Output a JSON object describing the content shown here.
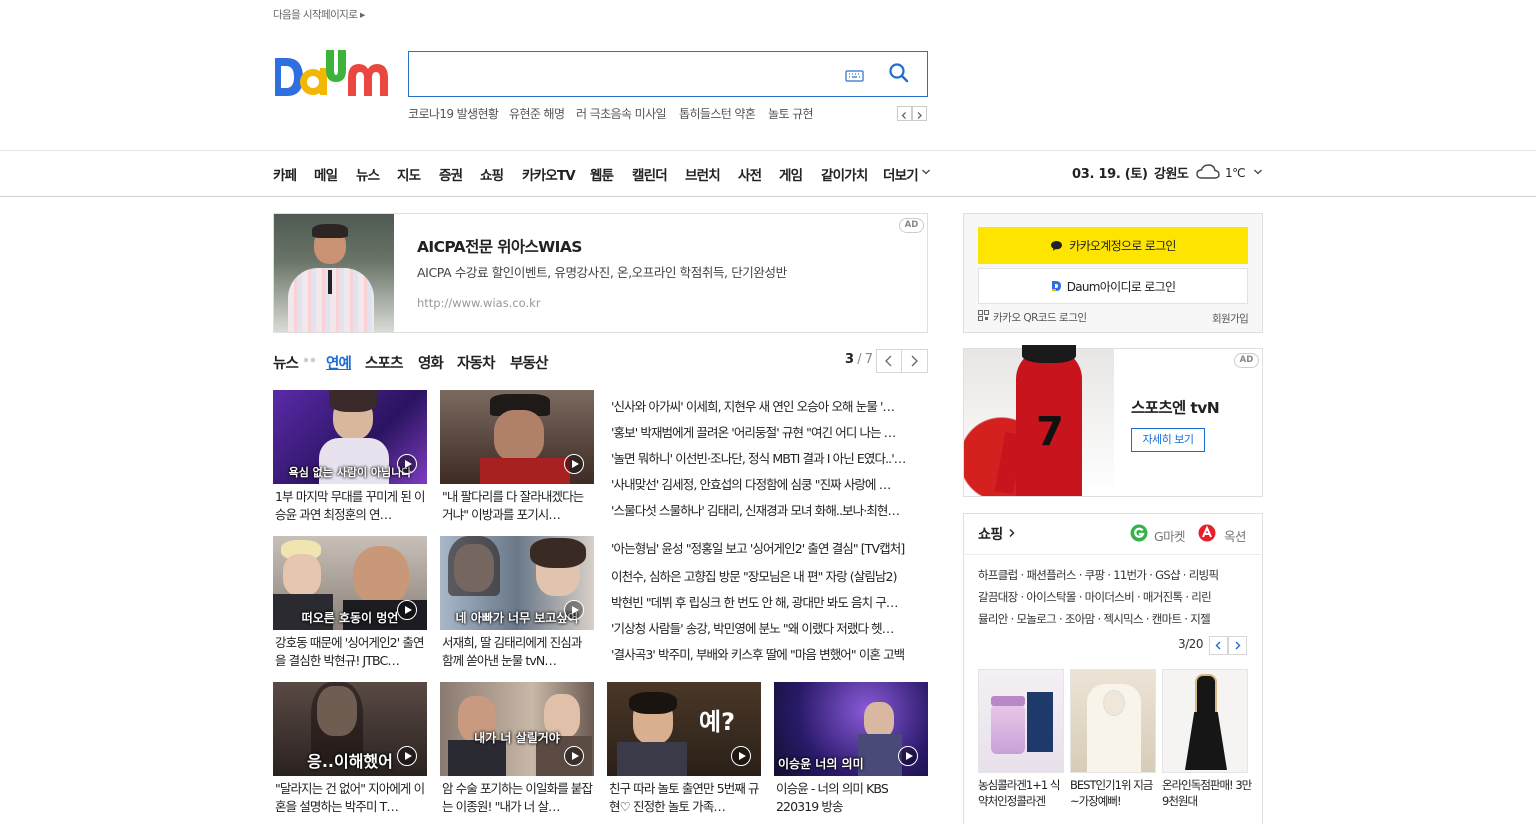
{
  "top": {
    "start_link": "다음을 시작페이지로"
  },
  "search": {
    "placeholder": ""
  },
  "trending": [
    "코로나19 발생현황",
    "유현준 해명",
    "러 극초음속 미사일",
    "톱히들스턴 약혼",
    "놀토 규현"
  ],
  "gnb": [
    "카페",
    "메일",
    "뉴스",
    "지도",
    "증권",
    "쇼핑",
    "카카오TV",
    "웹툰",
    "캘린더",
    "브런치",
    "사전",
    "게임",
    "같이가치",
    "더보기"
  ],
  "weather": {
    "date": "03. 19. (토)",
    "region": "강원도",
    "temp": "1℃"
  },
  "ad": {
    "badge": "AD",
    "title": "AICPA전문 위아스WIAS",
    "desc": "AICPA 수강료 할인이벤트, 유명강사진, 온,오프라인 학점취득, 단기완성반",
    "url": "http://www.wias.co.kr"
  },
  "news_tabs": {
    "items": [
      "뉴스",
      "연예",
      "스포츠",
      "영화",
      "자동차",
      "부동산"
    ],
    "page_current": "3",
    "page_total": "/ 7"
  },
  "cards_left": [
    {
      "title": "1부 마지막 무대를 꾸미게 된 이승윤 과연 최정훈의 연…",
      "caption": "욕심 없는 사람이 아님니다"
    },
    {
      "title": "\"내 팔다리를 다 잘라내겠다는 거냐\" 이방과를 포기시…",
      "caption": ""
    },
    {
      "title": "강호동 때문에 '싱어게인2' 출연을 결심한 박현규! JTBC…",
      "caption": "떠오른 호동이 멍언"
    },
    {
      "title": "서재희, 딸 김태리에게 진심과 함께 쏟아낸 눈물 tvN…",
      "caption": "네 아빠가 너무 보고싶어"
    }
  ],
  "headlines": [
    "'신사와 아가씨' 이세희, 지현우 새 연인 오승아 오해 눈물 '…",
    "'홍보' 박재범에게 끌려온 '어리둥절' 규현 \"여긴 어디 나는 …",
    "'놀면 뭐하니' 이선빈·조나단, 정식 MBTI 결과 I 아닌 E였다..'…",
    "'사내맞선' 김세정, 안효섭의 다정함에 심쿵 \"진짜 사랑에 …",
    "'스물다섯 스물하나' 김태리, 신재경과 모녀 화해..보나·최현…",
    "'아는형님' 윤성 \"정홍일 보고 '싱어게인2' 출연 결심\" [TV캡처]",
    "이천수, 심하은 고향집 방문 \"장모님은 내 편\" 자랑 (살림남2)",
    "박현빈 \"데뷔 후 립싱크 한 번도 안 해, 광대만 봐도 음치 구…",
    "'기상청 사람들' 송강, 박민영에 분노 \"왜 이랬다 저랬다 헷…",
    "'결사곡3' 박주미, 부배와 키스후 딸에 \"마음 변했어\" 이혼 고백"
  ],
  "cards_bottom": [
    {
      "title": "\"달라지는 건 없어\" 지아에게 이혼을 설명하는 박주미 T…",
      "caption": "응..이해했어"
    },
    {
      "title": "암 수술 포기하는 이일화를 붙잡는 이종원! \"내가 너 살…",
      "caption": "내가 너 살릴거야"
    },
    {
      "title": "친구 따라 놀토 출연만 5번째 규현♡ 진정한 놀토 가족…",
      "caption": "예?"
    },
    {
      "title": "이승윤 - 너의 의미 KBS 220319 방송",
      "caption": "이승윤 너의 의미"
    }
  ],
  "login": {
    "kakao_label": "카카오계정으로 로그인",
    "daum_label": "Daum아이디로 로그인",
    "qr_label": "카카오 QR코드 로그인",
    "signup_label": "회원가입"
  },
  "ad2": {
    "badge": "AD",
    "title": "스포츠엔 tvN",
    "button": "자세히 보기",
    "jersey_number": "7"
  },
  "shopping": {
    "title": "쇼핑",
    "gmarket": "G마켓",
    "auction": "옥션",
    "links": [
      "하프클럽 · 패션플러스 · 쿠팡 · 11번가 · GS샵 · 리빙픽",
      "갈끔대장 · 아이스탁몰 · 마이더스비 · 매거진톡 · 리린",
      "뮬리안 · 모놀로그 · 조아맘 · 젝시믹스 · 캔마트 · 지젤"
    ],
    "page": "3/20",
    "products": [
      {
        "title": "농심콜라겐1+1 식약처인정콜라겐"
      },
      {
        "title": "BEST인기1위 지금~가장예뻐!"
      },
      {
        "title": "온라인독점판매! 3만9천원대"
      }
    ]
  },
  "colors": {
    "accent_blue": "#1a6dd6",
    "search_border": "#2a6fc9",
    "kakao_yellow": "#fee500"
  }
}
